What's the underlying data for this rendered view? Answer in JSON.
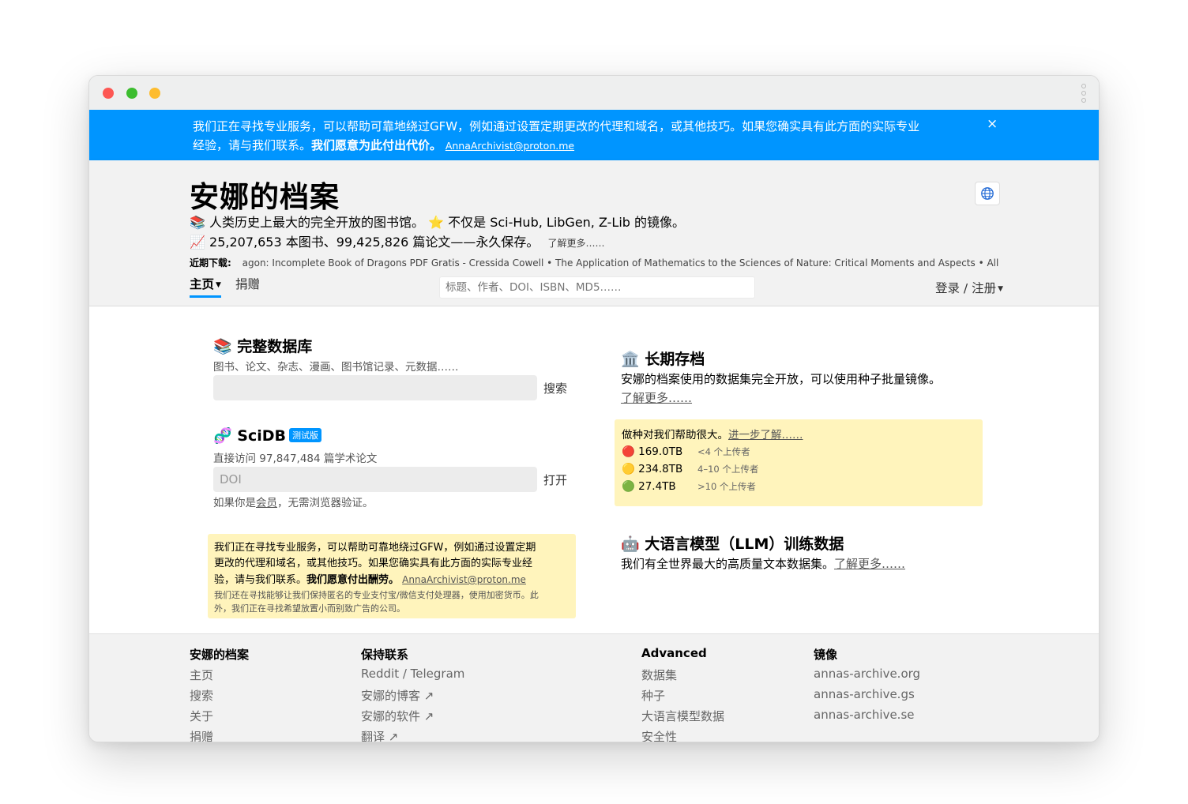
{
  "banner": {
    "line1": "我们正在寻找专业服务，可以帮助可靠地绕过GFW，例如通过设置定期更改的代理和域名，或其他技巧。如果您确实具有此方面的实际专业",
    "line2_text": "经验，请与我们联系。",
    "line2_bold": "我们愿意为此付出代价。",
    "email": "AnnaArchivist@proton.me",
    "close": "×"
  },
  "header": {
    "title": "安娜的档案",
    "tagline1_icon": "📚",
    "tagline1": "人类历史上最大的完全开放的图书馆。",
    "tagline1b_icon": "⭐️",
    "tagline1b": "不仅是 Sci-Hub, LibGen, Z-Lib 的镜像。",
    "tagline2_icon": "📈",
    "tagline2": "25,207,653 本图书、99,425,826 篇论文——永久保存。",
    "learn_more": "了解更多……",
    "recent_label": "近期下载:",
    "recent_items": "agon: Incomplete Book of Dragons PDF Gratis - Cressida Cowell • The Application of Mathematics to the Sciences of Nature: Critical Moments and Aspects • All",
    "nav_home": "主页",
    "nav_donate": "捐赠",
    "search_placeholder": "标题、作者、DOI、ISBN、MD5……",
    "login": "登录 / 注册"
  },
  "full_db": {
    "icon": "📚",
    "title": "完整数据库",
    "sub": "图书、论文、杂志、漫画、图书馆记录、元数据……",
    "button": "搜索"
  },
  "scidb": {
    "icon": "🧬",
    "title": "SciDB",
    "badge": "测试版",
    "sub": "直接访问 97,847,484 篇学术论文",
    "placeholder": "DOI",
    "button": "打开",
    "note_pre": "如果你是",
    "note_link": "会员",
    "note_post": "，无需浏览器验证。"
  },
  "notice": {
    "line1": "我们正在寻找专业服务，可以帮助可靠地绕过GFW，例如通过设置定期",
    "line2": "更改的代理和域名，或其他技巧。如果您确实具有此方面的实际专业经",
    "line3_text": "验，请与我们联系。",
    "line3_bold": "我们愿意付出酬劳。",
    "email": "AnnaArchivist@proton.me",
    "small1": "我们还在寻找能够让我们保持匿名的专业支付宝/微信支付处理器，使用加密货币。此",
    "small2": "外，我们正在寻找希望放置小而别致广告的公司。"
  },
  "archive": {
    "icon": "🏛️",
    "title": "长期存档",
    "text": "安娜的档案使用的数据集完全开放，可以使用种子批量镜像。",
    "link": "了解更多……"
  },
  "seeding": {
    "head_text": "做种对我们帮助很大。",
    "head_link": "进一步了解……",
    "rows": [
      {
        "icon": "🔴",
        "size": "169.0TB",
        "uploaders": "<4 个上传者"
      },
      {
        "icon": "🟡",
        "size": "234.8TB",
        "uploaders": "4–10 个上传者"
      },
      {
        "icon": "🟢",
        "size": "27.4TB",
        "uploaders": ">10 个上传者"
      }
    ]
  },
  "llm": {
    "icon": "🤖",
    "title": "大语言模型（LLM）训练数据",
    "text": "我们有全世界最大的高质量文本数据集。",
    "link": "了解更多……"
  },
  "footer": {
    "col1": {
      "title": "安娜的档案",
      "items": [
        "主页",
        "搜索",
        "关于",
        "捐赠"
      ]
    },
    "col2": {
      "title": "保持联系",
      "items": [
        "Reddit / Telegram",
        "安娜的博客 ↗",
        "安娜的软件 ↗",
        "翻译 ↗"
      ]
    },
    "col3": {
      "title": "Advanced",
      "items": [
        "数据集",
        "种子",
        "大语言模型数据",
        "安全性"
      ]
    },
    "col4": {
      "title": "镜像",
      "items": [
        "annas-archive.org",
        "annas-archive.gs",
        "annas-archive.se"
      ]
    }
  }
}
